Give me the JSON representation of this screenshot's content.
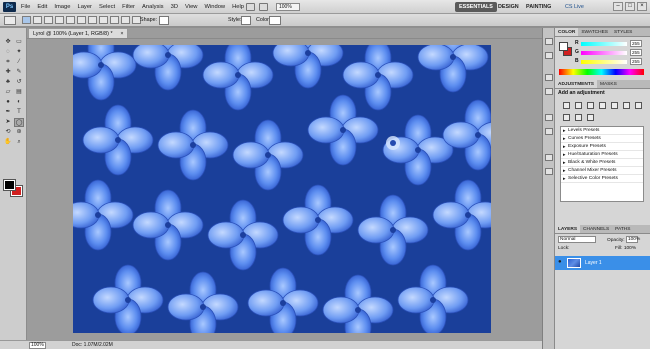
{
  "app": {
    "logo": "Ps",
    "menus": [
      "File",
      "Edit",
      "Image",
      "Layer",
      "Select",
      "Filter",
      "Analysis",
      "3D",
      "View",
      "Window",
      "Help"
    ],
    "zoom": "100%",
    "workspaces": [
      "ESSENTIALS",
      "DESIGN",
      "PAINTING"
    ],
    "cslive": "CS Live",
    "window_buttons": [
      "–",
      "□",
      "×"
    ]
  },
  "options": {
    "shape_label": "Shape:",
    "style_label": "Style:",
    "color_label": "Color:"
  },
  "document": {
    "tab_title": "Lyrol @ 100% (Layer 1, RGB/8) *",
    "tab_close": "×",
    "zoom": "100%",
    "doc_info": "Doc: 1.07M/2.02M"
  },
  "panels": {
    "top_tabs": [
      "COLOR",
      "SWATCHES",
      "STYLES"
    ],
    "color": {
      "rows": [
        {
          "label": "R",
          "value": "255"
        },
        {
          "label": "G",
          "value": "255"
        },
        {
          "label": "B",
          "value": "255"
        }
      ]
    },
    "adj_tabs": [
      "ADJUSTMENTS",
      "MASKS"
    ],
    "adj_title": "Add an adjustment",
    "presets": [
      "Levels Presets",
      "Curves Presets",
      "Exposure Presets",
      "Hue/Saturation Presets",
      "Black & White Presets",
      "Channel Mixer Presets",
      "Selective Color Presets"
    ],
    "layer_tabs": [
      "LAYERS",
      "CHANNELS",
      "PATHS"
    ],
    "blend_mode": "Normal",
    "opacity_label": "Opacity:",
    "opacity_value": "100%",
    "lock_label": "Lock:",
    "fill_label": "Fill:",
    "fill_value": "100%",
    "layer_name": "Layer 1"
  },
  "colors": {
    "accent": "#3a8fe8",
    "background_swatch": "#d11f1f",
    "foreground_swatch": "#000000"
  }
}
